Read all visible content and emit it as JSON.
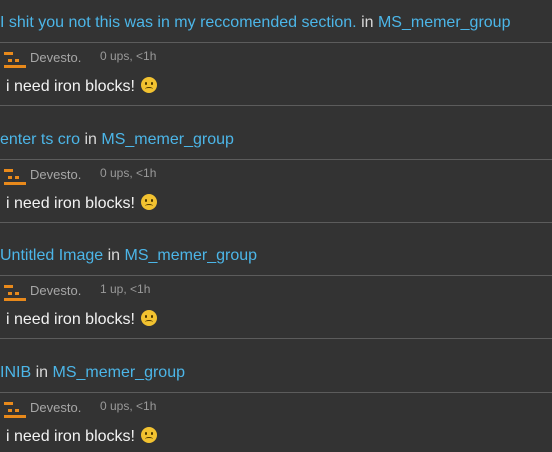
{
  "feed": {
    "entries": [
      {
        "title": "I shit you not this was in my reccomended section.",
        "in_word": "in",
        "group": "MS_memer_group",
        "comment": {
          "author": "Devesto.",
          "score": "0 ups, <1h",
          "text": "i need iron blocks!",
          "emoji": "frowning-face-icon"
        }
      },
      {
        "title": "enter ts cro",
        "in_word": "in",
        "group": "MS_memer_group",
        "comment": {
          "author": "Devesto.",
          "score": "0 ups, <1h",
          "text": "i need iron blocks!",
          "emoji": "frowning-face-icon"
        }
      },
      {
        "title": "Untitled Image",
        "in_word": "in",
        "group": "MS_memer_group",
        "comment": {
          "author": "Devesto.",
          "score": "1 up, <1h",
          "text": "i need iron blocks!",
          "emoji": "frowning-face-icon"
        }
      },
      {
        "title": "INIB",
        "in_word": "in",
        "group": "MS_memer_group",
        "comment": {
          "author": "Devesto.",
          "score": "0 ups, <1h",
          "text": "i need iron blocks!",
          "emoji": "frowning-face-icon"
        }
      }
    ]
  },
  "colors": {
    "background": "#333333",
    "link": "#4cb6e8",
    "divider": "#5c5c5c",
    "avatar": "#e8891b",
    "emoji": "#f2c230"
  }
}
